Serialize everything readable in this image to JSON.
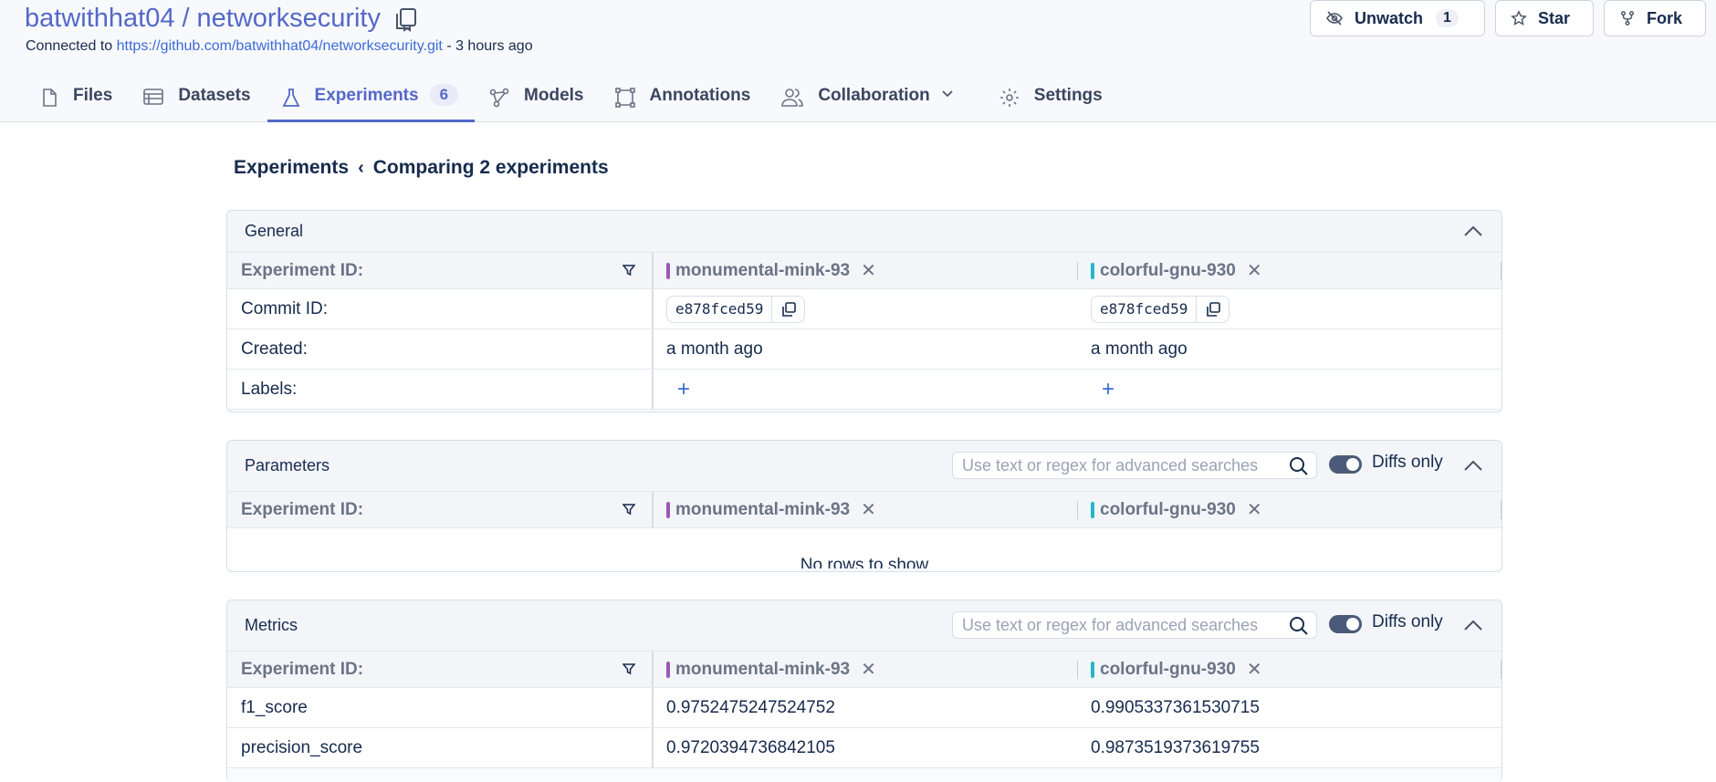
{
  "repo": {
    "owner": "batwithhat04",
    "separator": "/",
    "name": "networksecurity",
    "connected_prefix": "Connected to",
    "connected_url": "https://github.com/batwithhat04/networksecurity.git",
    "connected_suffix": "- 3 hours ago"
  },
  "header_buttons": {
    "unwatch_label": "Unwatch",
    "unwatch_count": "1",
    "star_label": "Star",
    "fork_label": "Fork"
  },
  "tabs": [
    {
      "label": "Files",
      "icon": "file-icon"
    },
    {
      "label": "Datasets",
      "icon": "dataset-icon"
    },
    {
      "label": "Experiments",
      "icon": "flask-icon",
      "badge": "6",
      "active": true
    },
    {
      "label": "Models",
      "icon": "model-icon"
    },
    {
      "label": "Annotations",
      "icon": "annotation-icon"
    },
    {
      "label": "Collaboration",
      "icon": "people-icon"
    },
    {
      "label": "Settings",
      "icon": "gear-icon"
    }
  ],
  "breadcrumb": {
    "root": "Experiments",
    "separator": "‹",
    "current": "Comparing 2 experiments"
  },
  "columns": {
    "id_header": "Experiment ID:",
    "exp1": {
      "name": "monumental-mink-93",
      "color": "#9b59b6"
    },
    "exp2": {
      "name": "colorful-gnu-930",
      "color": "#26b6c9"
    }
  },
  "general": {
    "title": "General",
    "rows": [
      {
        "label": "Commit ID:",
        "v1": "e878fced59",
        "v2": "e878fced59"
      },
      {
        "label": "Created:",
        "v1": "a month ago",
        "v2": "a month ago"
      },
      {
        "label": "Labels:",
        "v1": "+",
        "v2": "+"
      }
    ]
  },
  "parameters": {
    "title": "Parameters",
    "search_placeholder": "Use text or regex for advanced searches",
    "diffs_label": "Diffs only",
    "empty_text": "No rows to show"
  },
  "metrics": {
    "title": "Metrics",
    "search_placeholder": "Use text or regex for advanced searches",
    "diffs_label": "Diffs only",
    "rows": [
      {
        "label": "f1_score",
        "v1": "0.9752475247524752",
        "v2": "0.9905337361530715"
      },
      {
        "label": "precision_score",
        "v1": "0.9720394736842105",
        "v2": "0.9873519373619755"
      }
    ]
  }
}
